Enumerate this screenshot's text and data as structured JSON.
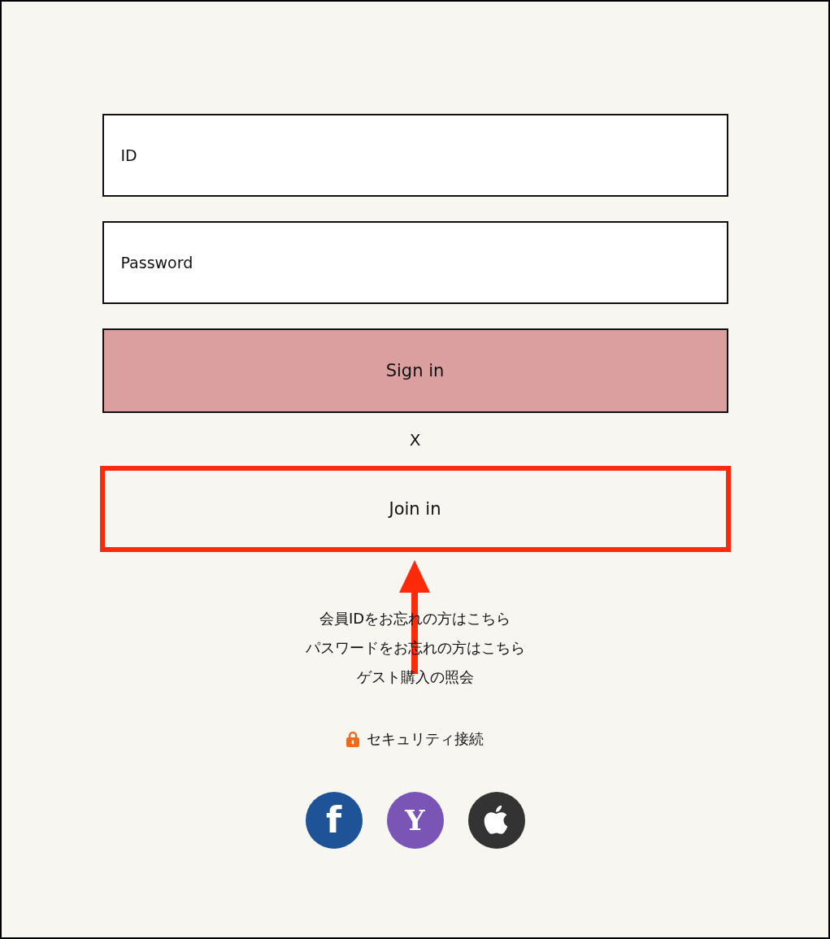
{
  "login_form": {
    "id_field": {
      "placeholder": "ID"
    },
    "password_field": {
      "placeholder": "Password"
    },
    "sign_in_button": {
      "label": "Sign in"
    },
    "separator": "X",
    "join_button": {
      "label": "Join in",
      "highlighted": true
    }
  },
  "links": [
    "会員IDをお忘れの方はこちら",
    "パスワードをお忘れの方はこちら",
    "ゲスト購入の照会"
  ],
  "security": {
    "label": "セキュリティ接続"
  },
  "social_buttons": [
    {
      "kind": "letter",
      "glyph": "f",
      "color": "#1e5397"
    },
    {
      "kind": "letter",
      "glyph": "Y",
      "color": "#7b55b6"
    },
    {
      "kind": "apple",
      "color": "#333333"
    }
  ]
}
